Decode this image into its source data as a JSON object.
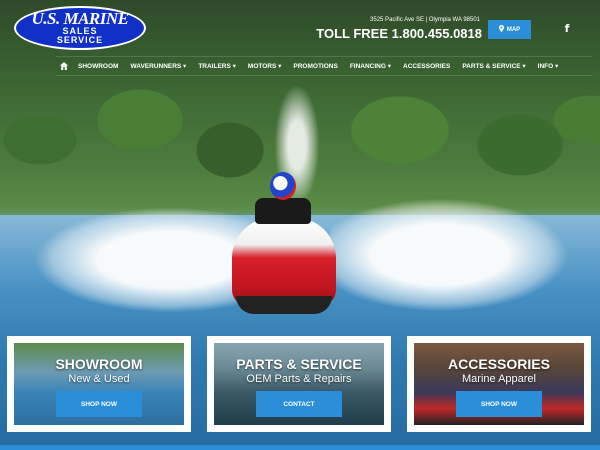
{
  "logo": {
    "line1": "U.S. MARINE",
    "line2": "SALES",
    "line3": "SERVICE"
  },
  "header": {
    "address": "3525 Pacific Ave SE | Olympia WA 98501",
    "phone": "TOLL FREE 1.800.455.0818",
    "map_label": "MAP"
  },
  "nav": {
    "items": [
      {
        "label": "SHOWROOM"
      },
      {
        "label": "WAVERUNNERS ▾"
      },
      {
        "label": "TRAILERS ▾"
      },
      {
        "label": "MOTORS ▾"
      },
      {
        "label": "PROMOTIONS"
      },
      {
        "label": "FINANCING ▾"
      },
      {
        "label": "ACCESSORIES"
      },
      {
        "label": "PARTS & SERVICE ▾"
      },
      {
        "label": "INFO ▾"
      }
    ]
  },
  "tiles": [
    {
      "title": "SHOWROOM",
      "subtitle": "New & Used",
      "button": "SHOP NOW"
    },
    {
      "title": "PARTS & SERVICE",
      "subtitle": "OEM Parts & Repairs",
      "button": "CONTACT"
    },
    {
      "title": "ACCESSORIES",
      "subtitle": "Marine Apparel",
      "button": "SHOP NOW"
    }
  ],
  "icons": {
    "home": "home-icon",
    "map_pin": "map-pin-icon",
    "facebook": "facebook-icon"
  },
  "colors": {
    "accent": "#2a8fd8",
    "logo_blue": "#1030c8"
  }
}
